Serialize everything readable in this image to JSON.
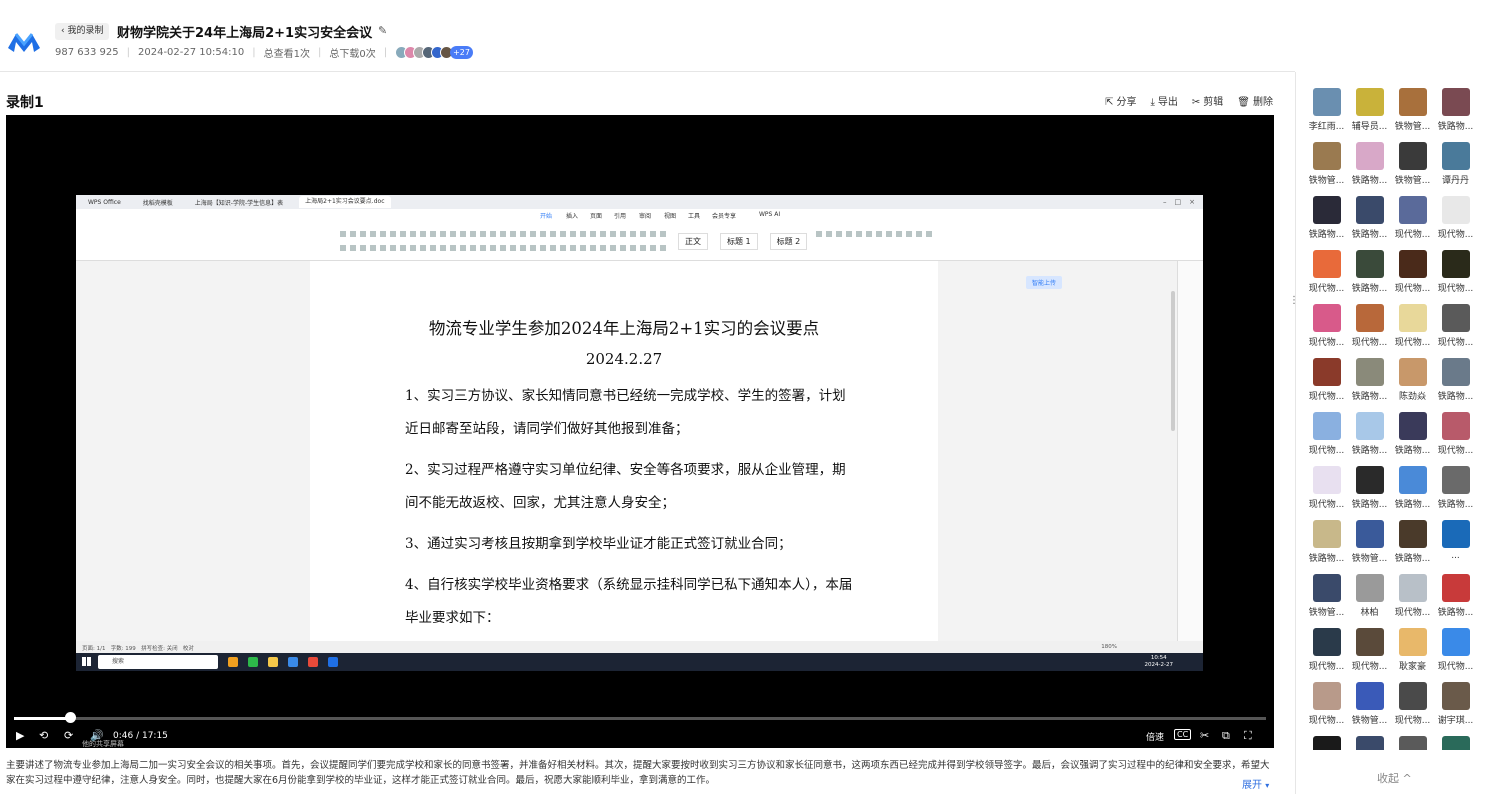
{
  "header": {
    "back_label": "我的录制",
    "title": "财物学院关于24年上海局2+1实习安全会议",
    "meeting_id": "987 633 925",
    "datetime": "2024-02-27 10:54:10",
    "views": "总查看1次",
    "downloads": "总下载0次",
    "viewer_count": "+27"
  },
  "recording": {
    "title": "录制1",
    "actions": {
      "share": "分享",
      "export": "导出",
      "edit": "剪辑",
      "delete": "删除"
    }
  },
  "screen": {
    "tabs": [
      "WPS Office",
      "找稻壳模板",
      "上海局【知识-学院-学生信息】表",
      "上海局2+1实习会议要点.doc"
    ],
    "menus": [
      "开始",
      "插入",
      "页面",
      "引用",
      "审阅",
      "视图",
      "工具",
      "会员专享",
      "WPS AI"
    ],
    "styles": [
      "正文",
      "标题 1",
      "标题 2"
    ],
    "share_btn": "分享",
    "upload_btn": "智能上传",
    "doc": {
      "title": "物流专业学生参加2024年上海局2+1实习的会议要点",
      "date": "2024.2.27",
      "paragraphs": [
        "1、实习三方协议、家长知情同意书已经统一完成学校、学生的签署，计划近日邮寄至站段，请同学们做好其他报到准备；",
        "2、实习过程严格遵守实习单位纪律、安全等各项要求，服从企业管理，期间不能无故返校、回家，尤其注意人身安全；",
        "3、通过实习考核且按期拿到学校毕业证才能正式签订就业合同；",
        "4、自行核实学校毕业资格要求（系统显示挂科同学已私下通知本人），本届毕业要求如下："
      ]
    },
    "status": {
      "page": "页面: 1/1",
      "words": "字数: 199",
      "spell": "拼写检查: 关闭",
      "proof": "校对",
      "zoom": "180%"
    },
    "taskbar": {
      "search": "搜索",
      "time": "10:54",
      "date": "2024-2-27"
    }
  },
  "player": {
    "time": "0:46 / 17:15",
    "progress": 0.0444,
    "speed_label": "倍速",
    "cc_label": "CC",
    "share_screen_label": "他的共享屏幕"
  },
  "summary": {
    "text": "主要讲述了物流专业参加上海局二加一实习安全会议的相关事项。首先，会议提醒同学们要完成学校和家长的同意书签署，并准备好相关材料。其次，提醒大家要按时收到实习三方协议和家长征同意书，这两项东西已经完成并得到学校领导签字。最后，会议强调了实习过程中的纪律和安全要求，希望大家在实习过程中遵守纪律，注意人身安全。同时，也提醒大家在6月份能拿到学校的毕业证，这样才能正式签订就业合同。最后，祝愿大家能顺利毕业，拿到满意的工作。",
    "expand_label": "展开"
  },
  "attendees": [
    {
      "name": "李红雨...",
      "color": "#6a8fb0"
    },
    {
      "name": "辅导员...",
      "color": "#c9b23a"
    },
    {
      "name": "铁物管...",
      "color": "#a8703c"
    },
    {
      "name": "铁路物...",
      "color": "#7a4a52"
    },
    {
      "name": "铁物管...",
      "color": "#9a7a50"
    },
    {
      "name": "铁路物...",
      "color": "#d8a8c8"
    },
    {
      "name": "铁物管...",
      "color": "#3a3a3a"
    },
    {
      "name": "谭丹丹",
      "color": "#4a7a9a"
    },
    {
      "name": "铁路物...",
      "color": "#2a2a38"
    },
    {
      "name": "铁路物...",
      "color": "#3a4a6a"
    },
    {
      "name": "现代物...",
      "color": "#5a6a9a"
    },
    {
      "name": "现代物...",
      "color": "#e8e8e8"
    },
    {
      "name": "现代物...",
      "color": "#e86a3a"
    },
    {
      "name": "铁路物...",
      "color": "#3a4a3a"
    },
    {
      "name": "现代物...",
      "color": "#4a2a1a"
    },
    {
      "name": "现代物...",
      "color": "#2a2a1a"
    },
    {
      "name": "现代物...",
      "color": "#d85a8a"
    },
    {
      "name": "现代物...",
      "color": "#b8683a"
    },
    {
      "name": "现代物...",
      "color": "#e8d89a"
    },
    {
      "name": "现代物...",
      "color": "#5a5a5a"
    },
    {
      "name": "现代物...",
      "color": "#8a3a2a"
    },
    {
      "name": "铁路物...",
      "color": "#8a8a7a"
    },
    {
      "name": "陈劲焱",
      "color": "#c8986a"
    },
    {
      "name": "铁路物...",
      "color": "#6a7a8a"
    },
    {
      "name": "现代物...",
      "color": "#8ab0e0"
    },
    {
      "name": "铁路物...",
      "color": "#a8c8e8"
    },
    {
      "name": "铁路物...",
      "color": "#3a3a5a"
    },
    {
      "name": "现代物...",
      "color": "#b85a6a"
    },
    {
      "name": "现代物...",
      "color": "#e8e0f0"
    },
    {
      "name": "铁路物...",
      "color": "#2a2a2a"
    },
    {
      "name": "铁路物...",
      "color": "#4a8ad8"
    },
    {
      "name": "铁路物...",
      "color": "#6a6a6a"
    },
    {
      "name": "铁路物...",
      "color": "#c8b88a"
    },
    {
      "name": "铁物管...",
      "color": "#3a5a9a"
    },
    {
      "name": "铁路物...",
      "color": "#4a3a2a"
    },
    {
      "name": "...",
      "color": "#1a6ab8"
    },
    {
      "name": "铁物管...",
      "color": "#3a4a6a"
    },
    {
      "name": "林柏",
      "color": "#9a9a9a"
    },
    {
      "name": "现代物...",
      "color": "#b8c0c8"
    },
    {
      "name": "铁路物...",
      "color": "#c83a3a"
    },
    {
      "name": "现代物...",
      "color": "#2a3a4a"
    },
    {
      "name": "现代物...",
      "color": "#5a4a3a"
    },
    {
      "name": "耿家豪",
      "color": "#e8b86a"
    },
    {
      "name": "现代物...",
      "color": "#3a8ae8"
    },
    {
      "name": "现代物...",
      "color": "#b89a8a"
    },
    {
      "name": "铁物管...",
      "color": "#3a5ab8"
    },
    {
      "name": "现代物...",
      "color": "#4a4a4a"
    },
    {
      "name": "谢宇琪...",
      "color": "#6a5a4a"
    },
    {
      "name": "",
      "color": "#1a1a1a"
    },
    {
      "name": "",
      "color": "#3a4a6a"
    },
    {
      "name": "",
      "color": "#5a5a5a"
    },
    {
      "name": "",
      "color": "#2a6a5a"
    }
  ],
  "panel": {
    "collapse_label": "收起"
  }
}
